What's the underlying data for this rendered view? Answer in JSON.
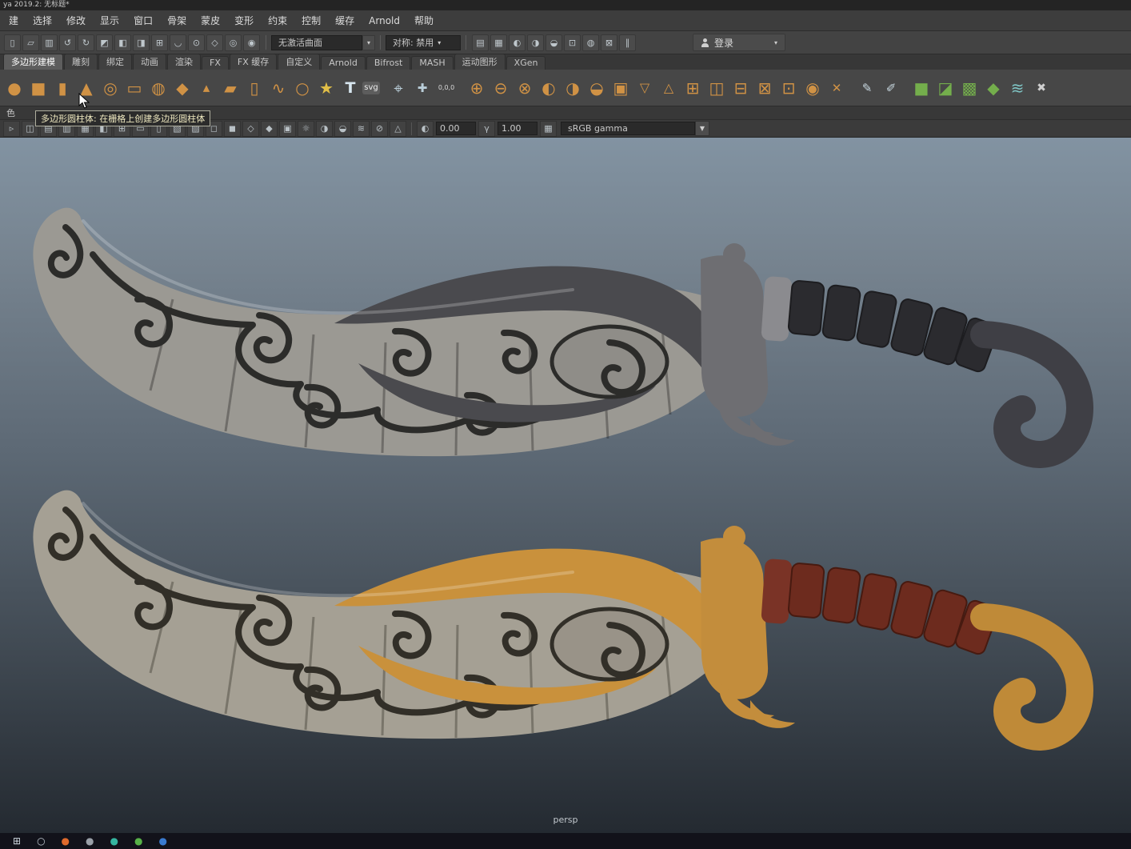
{
  "window": {
    "title": "ya 2019.2: 无标题*"
  },
  "menubar": {
    "items": [
      {
        "label": "建"
      },
      {
        "label": "选择"
      },
      {
        "label": "修改"
      },
      {
        "label": "显示"
      },
      {
        "label": "窗口"
      },
      {
        "label": "骨架"
      },
      {
        "label": "蒙皮"
      },
      {
        "label": "变形"
      },
      {
        "label": "约束"
      },
      {
        "label": "控制"
      },
      {
        "label": "缓存"
      },
      {
        "label": "Arnold"
      },
      {
        "label": "帮助"
      }
    ]
  },
  "statusbar": {
    "left_icons": [
      {
        "name": "new-scene-icon",
        "glyph": "▯"
      },
      {
        "name": "open-scene-icon",
        "glyph": "▱"
      },
      {
        "name": "save-scene-icon",
        "glyph": "▥"
      },
      {
        "name": "undo-icon",
        "glyph": "↺"
      },
      {
        "name": "redo-icon",
        "glyph": "↻"
      },
      {
        "name": "select-hierarchy-icon",
        "glyph": "◩"
      },
      {
        "name": "select-object-icon",
        "glyph": "◧"
      },
      {
        "name": "select-component-icon",
        "glyph": "◨"
      },
      {
        "name": "snap-grid-icon",
        "glyph": "⊞"
      },
      {
        "name": "snap-curve-icon",
        "glyph": "◡"
      },
      {
        "name": "snap-point-icon",
        "glyph": "⊙"
      },
      {
        "name": "snap-plane-icon",
        "glyph": "◇"
      },
      {
        "name": "snap-view-icon",
        "glyph": "◎"
      },
      {
        "name": "make-live-icon",
        "glyph": "◉"
      }
    ],
    "no_active_surface": "无激活曲面",
    "symmetry": "对称: 禁用",
    "right_icons": [
      {
        "name": "construction-history-icon",
        "glyph": "▤"
      },
      {
        "name": "render-view-icon",
        "glyph": "▦"
      },
      {
        "name": "render-current-frame-icon",
        "glyph": "◐"
      },
      {
        "name": "ipr-render-icon",
        "glyph": "◑"
      },
      {
        "name": "render-settings-icon",
        "glyph": "◒"
      },
      {
        "name": "display-globals-icon",
        "glyph": "⊡"
      },
      {
        "name": "arnold-render-icon",
        "glyph": "◍"
      },
      {
        "name": "cut-section-icon",
        "glyph": "⊠"
      },
      {
        "name": "pause-icon",
        "glyph": "∥"
      }
    ],
    "login": "登录"
  },
  "shelf": {
    "tabs": [
      {
        "label": "多边形建模",
        "active": "true"
      },
      {
        "label": "雕刻"
      },
      {
        "label": "绑定"
      },
      {
        "label": "动画"
      },
      {
        "label": "渲染"
      },
      {
        "label": "FX"
      },
      {
        "label": "FX 缓存"
      },
      {
        "label": "自定义"
      },
      {
        "label": "Arnold"
      },
      {
        "label": "Bifrost"
      },
      {
        "label": "MASH"
      },
      {
        "label": "运动图形"
      },
      {
        "label": "XGen"
      }
    ],
    "icons": [
      {
        "name": "shelf-poly-sphere-icon",
        "glyph": "●",
        "style": "color:#d09245"
      },
      {
        "name": "shelf-poly-cube-icon",
        "glyph": "■",
        "style": "color:#d09245"
      },
      {
        "name": "shelf-poly-cylinder-icon",
        "glyph": "▮",
        "style": "color:#d09245"
      },
      {
        "name": "shelf-poly-cone-icon",
        "glyph": "▲",
        "style": "color:#d09245"
      },
      {
        "name": "shelf-poly-torus-icon",
        "glyph": "◎",
        "style": "color:#d09245"
      },
      {
        "name": "shelf-poly-plane-icon",
        "glyph": "▭",
        "style": "color:#d09245"
      },
      {
        "name": "shelf-poly-disc-icon",
        "glyph": "◍",
        "style": "color:#d09245"
      },
      {
        "name": "shelf-poly-platonic-icon",
        "glyph": "◆",
        "style": "color:#d09245"
      },
      {
        "name": "shelf-poly-pyramid-icon",
        "glyph": "▴",
        "style": "color:#d09245;font-size:17px"
      },
      {
        "name": "shelf-poly-prism-icon",
        "glyph": "▰",
        "style": "color:#d09245"
      },
      {
        "name": "shelf-poly-pipe-icon",
        "glyph": "▯",
        "style": "color:#d09245"
      },
      {
        "name": "shelf-poly-helix-icon",
        "glyph": "∿",
        "style": "color:#d09245"
      },
      {
        "name": "shelf-poly-soccerball-icon",
        "glyph": "○",
        "style": "color:#d09245"
      },
      {
        "name": "shelf-superellipse-icon",
        "glyph": "★",
        "style": "color:#e2bf47"
      },
      {
        "name": "shelf-type-tool-icon",
        "glyph": "T",
        "style": "color:#d7e6ef;font-weight:bold;font-size:19px"
      },
      {
        "name": "shelf-svg-tool-icon",
        "glyph": "svg",
        "style": "color:#efefef;font-size:10px;background:#5d5d5d;border-radius:3px;width:22px;height:16px"
      },
      {
        "name": "separator",
        "glyph": "",
        "style": "width:8px"
      },
      {
        "name": "shelf-snap-align-icon",
        "glyph": "⌖",
        "style": "color:#b9cdd8"
      },
      {
        "name": "shelf-axis-align-icon",
        "glyph": "✚",
        "style": "color:#b9cdd8;font-size:15px"
      },
      {
        "name": "shelf-move-to-origin-icon",
        "glyph": "0,0,0",
        "style": "color:#d8d8d8;font-size:8px"
      },
      {
        "name": "separator",
        "glyph": "",
        "style": "width:8px"
      },
      {
        "name": "shelf-combine-icon",
        "glyph": "⊕",
        "style": "color:#d09245"
      },
      {
        "name": "shelf-separate-icon",
        "glyph": "⊖",
        "style": "color:#d09245"
      },
      {
        "name": "shelf-extract-icon",
        "glyph": "⊗",
        "style": "color:#d09245"
      },
      {
        "name": "shelf-boolean-union-icon",
        "glyph": "◐",
        "style": "color:#d09245"
      },
      {
        "name": "shelf-boolean-difference-icon",
        "glyph": "◑",
        "style": "color:#d09245"
      },
      {
        "name": "shelf-boolean-intersect-icon",
        "glyph": "◒",
        "style": "color:#d09245"
      },
      {
        "name": "shelf-smooth-icon",
        "glyph": "▣",
        "style": "color:#d09245"
      },
      {
        "name": "shelf-reduce-icon",
        "glyph": "▽",
        "style": "color:#d09245;font-size:16px"
      },
      {
        "name": "shelf-triangulate-icon",
        "glyph": "△",
        "style": "color:#d09245;font-size:16px"
      },
      {
        "name": "shelf-quadrangulate-icon",
        "glyph": "⊞",
        "style": "color:#d09245"
      },
      {
        "name": "shelf-mirror-icon",
        "glyph": "◫",
        "style": "color:#d09245"
      },
      {
        "name": "shelf-bevel-icon",
        "glyph": "⊟",
        "style": "color:#d09245"
      },
      {
        "name": "shelf-bridge-icon",
        "glyph": "⊠",
        "style": "color:#d09245"
      },
      {
        "name": "shelf-extrude-icon",
        "glyph": "⊡",
        "style": "color:#d09245"
      },
      {
        "name": "shelf-merge-vertices-icon",
        "glyph": "◉",
        "style": "color:#d09245"
      },
      {
        "name": "shelf-multi-cut-icon",
        "glyph": "✕",
        "style": "color:#d09245;font-size:15px"
      },
      {
        "name": "separator",
        "glyph": "",
        "style": "width:8px"
      },
      {
        "name": "shelf-quad-draw-icon",
        "glyph": "✎",
        "style": "color:#c8d8e0;font-size:15px"
      },
      {
        "name": "shelf-sculpt-tool-icon",
        "glyph": "✐",
        "style": "color:#c8d8e0;font-size:15px"
      },
      {
        "name": "separator",
        "glyph": "",
        "style": "width:8px"
      },
      {
        "name": "shelf-uv-editor-icon",
        "glyph": "■",
        "style": "color:#74ae4c"
      },
      {
        "name": "shelf-uv-unfold-icon",
        "glyph": "◪",
        "style": "color:#74ae4c"
      },
      {
        "name": "shelf-uv-layout-icon",
        "glyph": "▩",
        "style": "color:#74ae4c"
      },
      {
        "name": "shelf-uv-cut-icon",
        "glyph": "◆",
        "style": "color:#74ae4c"
      },
      {
        "name": "shelf-wave-deform-icon",
        "glyph": "≋",
        "style": "color:#7fc4c4"
      },
      {
        "name": "shelf-delete-history-icon",
        "glyph": "✖",
        "style": "color:#d0d0d0;font-size:14px"
      }
    ]
  },
  "tooltip": {
    "text": "多边形圆柱体: 在栅格上创建多边形圆柱体"
  },
  "panel_menu": {
    "visible_item": "色"
  },
  "viewport_toolbar": {
    "icons": [
      {
        "name": "select-camera-icon",
        "glyph": "▹"
      },
      {
        "name": "lock-camera-icon",
        "glyph": "◫"
      },
      {
        "name": "camera-attributes-icon",
        "glyph": "▤"
      },
      {
        "name": "bookmarks-icon",
        "glyph": "▥"
      },
      {
        "name": "image-plane-icon",
        "glyph": "▦"
      },
      {
        "name": "two-panes-icon",
        "glyph": "◧"
      },
      {
        "name": "grid-icon",
        "glyph": "⊞"
      },
      {
        "name": "film-gate-icon",
        "glyph": "▭"
      },
      {
        "name": "resolution-gate-icon",
        "glyph": "▯"
      },
      {
        "name": "gate-mask-icon",
        "glyph": "▧"
      },
      {
        "name": "field-chart-icon",
        "glyph": "▨"
      },
      {
        "name": "safe-action-icon",
        "glyph": "◻"
      },
      {
        "name": "safe-title-icon",
        "glyph": "◼"
      },
      {
        "name": "wireframe-icon",
        "glyph": "◇"
      },
      {
        "name": "shaded-icon",
        "glyph": "◆"
      },
      {
        "name": "textured-icon",
        "glyph": "▣"
      },
      {
        "name": "use-all-lights-icon",
        "glyph": "☼"
      },
      {
        "name": "shadows-icon",
        "glyph": "◑"
      },
      {
        "name": "ambient-occlusion-icon",
        "glyph": "◒"
      },
      {
        "name": "motion-blur-icon",
        "glyph": "≋"
      },
      {
        "name": "xray-icon",
        "glyph": "⊘"
      },
      {
        "name": "isolate-select-icon",
        "glyph": "△"
      }
    ],
    "exposure": "0.00",
    "gamma": "1.00",
    "view_transform": "sRGB gamma"
  },
  "viewport": {
    "camera_label": "persp",
    "models": [
      {
        "name": "stylized-dagger-dark-gray"
      },
      {
        "name": "stylized-dagger-gold-textured"
      }
    ]
  },
  "taskbar": {
    "icons": [
      {
        "name": "taskbar-start-icon",
        "glyph": "⊞",
        "style": "color:#cfd8e0"
      },
      {
        "name": "taskbar-search-icon",
        "glyph": "○",
        "style": "color:#c0c8d0"
      },
      {
        "name": "taskbar-app-orange-icon",
        "glyph": "●",
        "style": "color:#e06a2c"
      },
      {
        "name": "taskbar-app-gray-icon",
        "glyph": "●",
        "style": "color:#9aa0a8"
      },
      {
        "name": "taskbar-app-teal-icon",
        "glyph": "●",
        "style": "color:#35b5a0"
      },
      {
        "name": "taskbar-app-green-icon",
        "glyph": "●",
        "style": "color:#58b248"
      },
      {
        "name": "taskbar-app-blue-icon",
        "glyph": "●",
        "style": "color:#3a7bd0"
      }
    ]
  },
  "colors": {
    "shelf_icon_orange": "#d09245",
    "panel_gray": "#434343",
    "viewport_gradient_top": "#8293a2",
    "viewport_gradient_bottom": "#242a31",
    "dagger_gold": "#c9913c",
    "dagger_grip_red": "#6d2b1e",
    "dagger_dark_metal": "#3f3f45"
  }
}
